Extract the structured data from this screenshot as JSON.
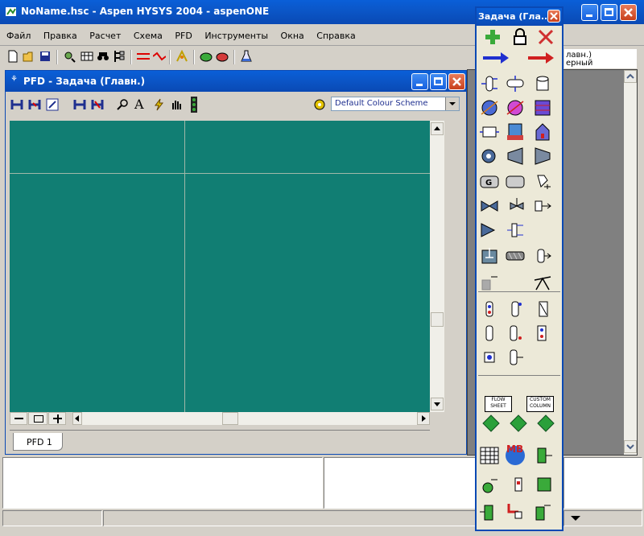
{
  "window": {
    "title": "NoName.hsc - Aspen HYSYS 2004 - aspenONE"
  },
  "menu": [
    "Файл",
    "Правка",
    "Расчет",
    "Схема",
    "PFD",
    "Инструменты",
    "Окна",
    "Справка"
  ],
  "pfd_window": {
    "title": "PFD - Задача (Главн.)",
    "colour_scheme": "Default Colour Scheme",
    "tab": "PFD 1"
  },
  "palette": {
    "title": "Задача (Гла...",
    "flowsheet_label": "FLOW SHEET",
    "column_label": "CUSTOM COLUMN"
  },
  "right_panel": {
    "line1": "лавн.)",
    "line2": "ерный"
  },
  "colors": {
    "canvas": "#117e73",
    "title_bar": "#0a5fd8",
    "chrome": "#d4d0c8"
  }
}
